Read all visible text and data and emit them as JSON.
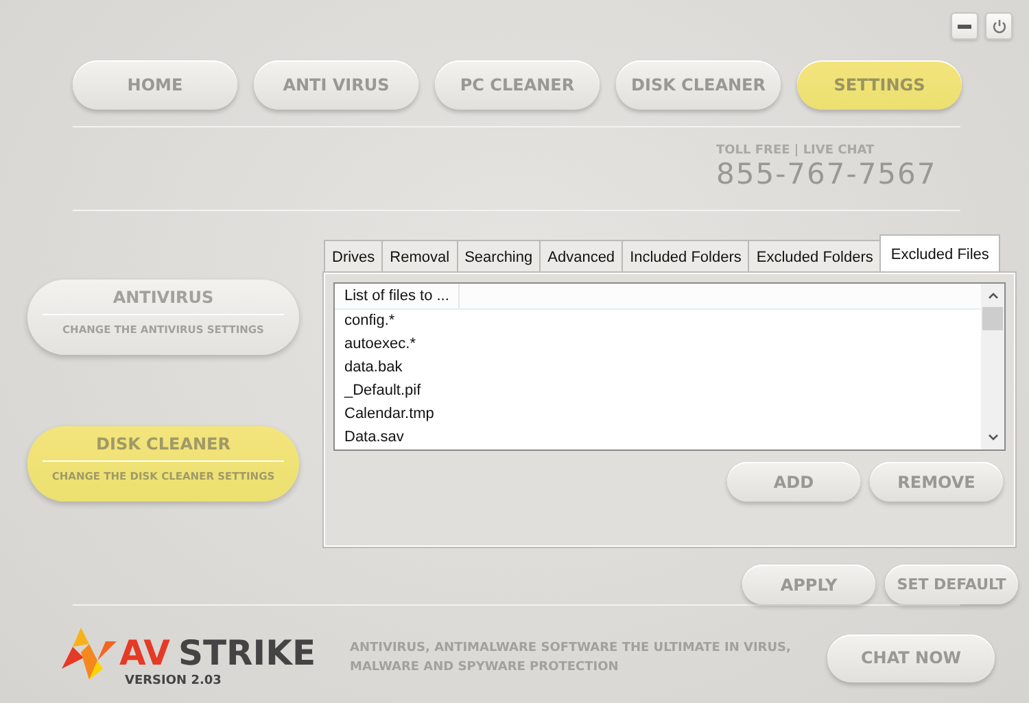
{
  "window_controls": [
    {
      "kind": "minimize"
    },
    {
      "kind": "power"
    }
  ],
  "nav": [
    {
      "label": "HOME",
      "selected": false
    },
    {
      "label": "ANTI VIRUS",
      "selected": false
    },
    {
      "label": "PC CLEANER",
      "selected": false
    },
    {
      "label": "DISK CLEANER",
      "selected": false
    },
    {
      "label": "SETTINGS",
      "selected": true
    }
  ],
  "contact": {
    "caption": "TOLL FREE | LIVE CHAT",
    "phone": "855-767-7567"
  },
  "sections": [
    {
      "title": "ANTIVIRUS",
      "subtitle": "CHANGE THE ANTIVIRUS SETTINGS",
      "selected": false
    },
    {
      "title": "DISK CLEANER",
      "subtitle": "CHANGE THE DISK CLEANER SETTINGS",
      "selected": true
    }
  ],
  "tabs": [
    {
      "label": "Drives",
      "selected": false
    },
    {
      "label": "Removal",
      "selected": false
    },
    {
      "label": "Searching",
      "selected": false
    },
    {
      "label": "Advanced",
      "selected": false
    },
    {
      "label": "Included Folders",
      "selected": false
    },
    {
      "label": "Excluded Folders",
      "selected": false
    },
    {
      "label": "Excluded Files",
      "selected": true
    }
  ],
  "file_list": {
    "column": "List of files to ...",
    "rows": [
      "config.*",
      "autoexec.*",
      "data.bak",
      "_Default.pif",
      "Calendar.tmp",
      "Data.sav"
    ]
  },
  "list_buttons": [
    "ADD",
    "REMOVE"
  ],
  "settings_buttons": [
    "APPLY",
    "SET DEFAULT"
  ],
  "footer": {
    "brand_first": "AV",
    "brand_second": "STRIKE",
    "version": "VERSION 2.03",
    "tagline": "ANTIVIRUS, ANTIMALWARE SOFTWARE THE ULTIMATE IN VIRUS, MALWARE AND SPYWARE PROTECTION",
    "chat_button": "CHAT NOW"
  }
}
